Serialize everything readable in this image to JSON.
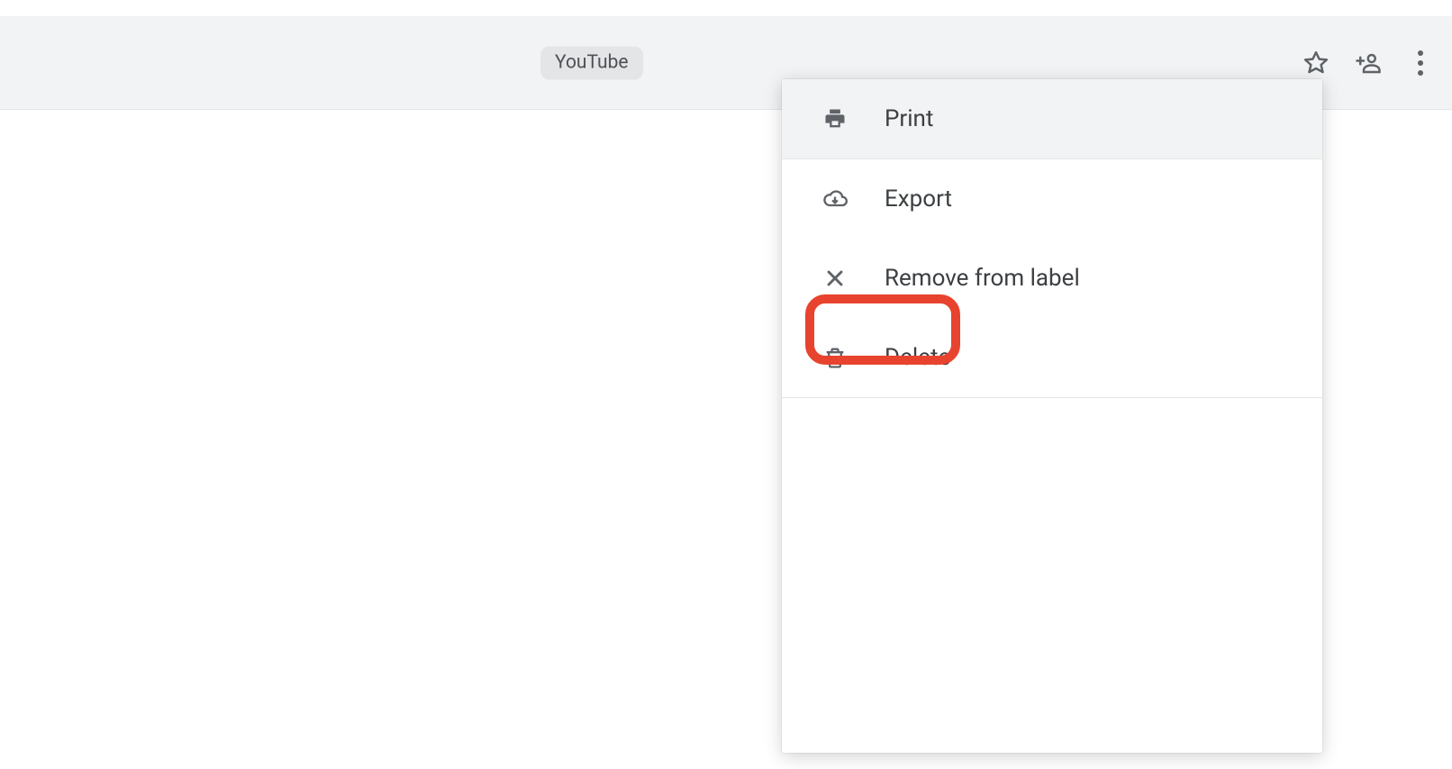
{
  "topbar": {
    "chip_label": "YouTube"
  },
  "menu": {
    "items": [
      {
        "label": "Print"
      },
      {
        "label": "Export"
      },
      {
        "label": "Remove from label"
      },
      {
        "label": "Delete"
      }
    ]
  }
}
